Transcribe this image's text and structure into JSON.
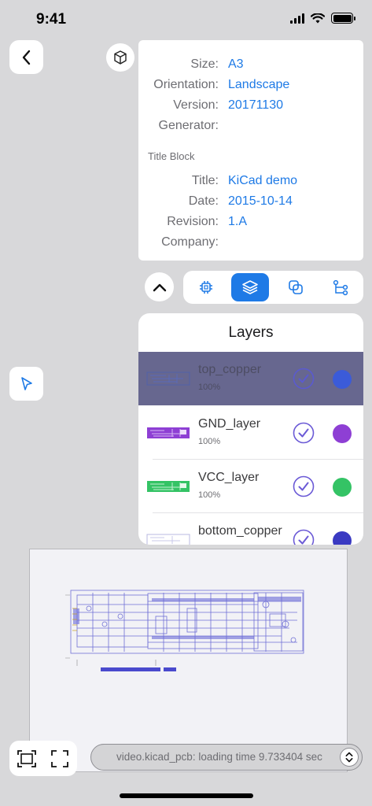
{
  "status_bar": {
    "time": "9:41"
  },
  "info": {
    "rows_top": [
      {
        "label": "Size:",
        "value": "A3"
      },
      {
        "label": "Orientation:",
        "value": "Landscape"
      },
      {
        "label": "Version:",
        "value": "20171130"
      },
      {
        "label": "Generator:",
        "value": ""
      }
    ],
    "section_title": "Title Block",
    "rows_bottom": [
      {
        "label": "Title:",
        "value": "KiCad demo"
      },
      {
        "label": "Date:",
        "value": "2015-10-14"
      },
      {
        "label": "Revision:",
        "value": "1.A"
      },
      {
        "label": "Company:",
        "value": ""
      }
    ]
  },
  "toolbar": {
    "tools": [
      {
        "icon": "chip-icon",
        "active": false
      },
      {
        "icon": "layers-icon",
        "active": true
      },
      {
        "icon": "overlap-icon",
        "active": false
      },
      {
        "icon": "netlist-icon",
        "active": false
      }
    ]
  },
  "layers": {
    "title": "Layers",
    "items": [
      {
        "name": "top_copper",
        "percent": "100%",
        "color": "#3b5bd9",
        "checked": true,
        "selected": true
      },
      {
        "name": "GND_layer",
        "percent": "100%",
        "color": "#8e3fd4",
        "checked": true,
        "selected": false
      },
      {
        "name": "VCC_layer",
        "percent": "100%",
        "color": "#34c365",
        "checked": true,
        "selected": false
      },
      {
        "name": "bottom_copper",
        "percent": "",
        "color": "#3a3ac2",
        "checked": true,
        "selected": false
      }
    ]
  },
  "status": {
    "message": "video.kicad_pcb: loading time 9.733404 sec"
  },
  "colors": {
    "accent": "#1e7ae6",
    "check": "#6b5ad6"
  }
}
